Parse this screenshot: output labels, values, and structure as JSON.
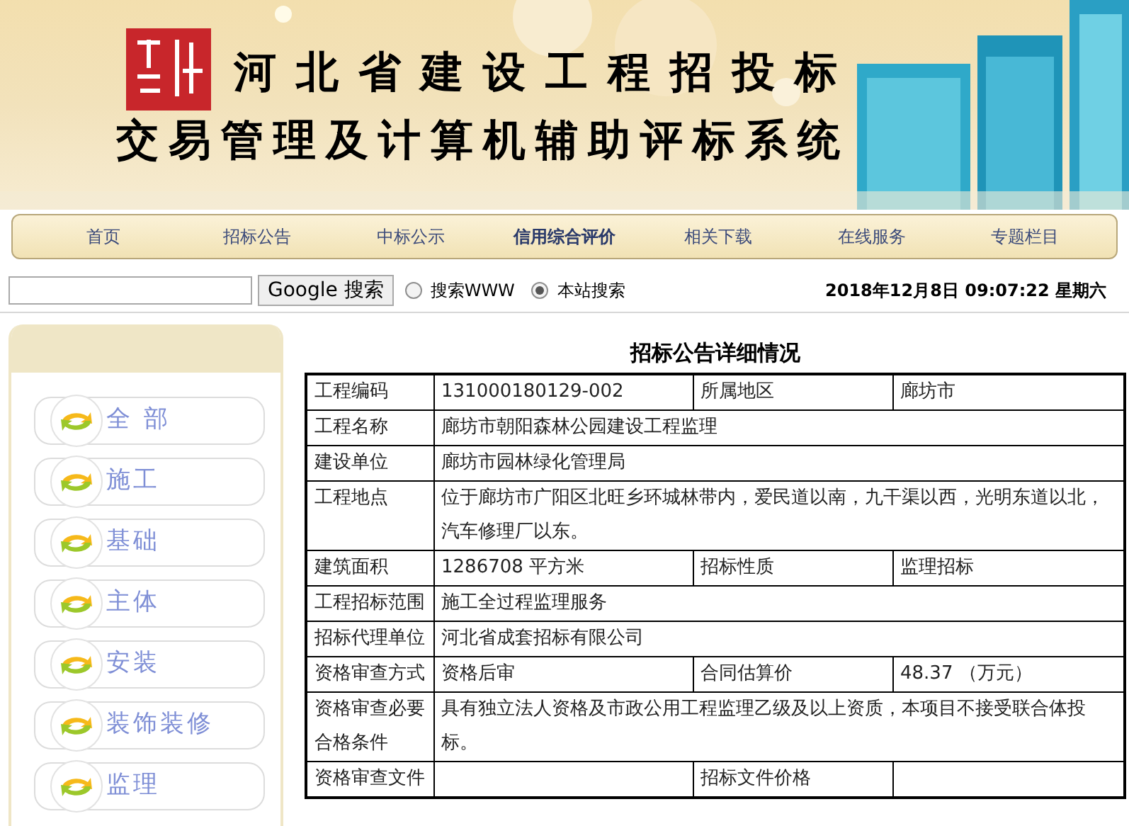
{
  "banner": {
    "title_line_1": "河北省建设工程招投标",
    "title_line_2": "交易管理及计算机辅助评标系统"
  },
  "nav": [
    {
      "label": "首页",
      "selected": false
    },
    {
      "label": "招标公告",
      "selected": false
    },
    {
      "label": "中标公示",
      "selected": false
    },
    {
      "label": "信用综合评价",
      "selected": true
    },
    {
      "label": "相关下载",
      "selected": false
    },
    {
      "label": "在线服务",
      "selected": false
    },
    {
      "label": "专题栏目",
      "selected": false
    }
  ],
  "search": {
    "button": "Google 搜索",
    "options": [
      {
        "label": "搜索WWW",
        "selected": false
      },
      {
        "label": "本站搜索",
        "selected": true
      }
    ]
  },
  "datetime": "2018年12月8日 09:07:22 星期六",
  "sidebar": {
    "items": [
      "全 部",
      "施工",
      "基础",
      "主体",
      "安装",
      "装饰装修",
      "监理"
    ]
  },
  "detail": {
    "title": "招标公告详细情况",
    "rows": [
      {
        "kind": "split",
        "label": "工程编码",
        "value": "131000180129-002",
        "label_2": "所属地区",
        "value_2": "廊坊市"
      },
      {
        "kind": "wide",
        "label": "工程名称",
        "value": "廊坊市朝阳森林公园建设工程监理"
      },
      {
        "kind": "wide",
        "label": "建设单位",
        "value": "廊坊市园林绿化管理局"
      },
      {
        "kind": "wide",
        "label": "工程地点",
        "value": "位于廊坊市广阳区北旺乡环城林带内，爱民道以南，九干渠以西，光明东道以北，汽车修理厂以东。"
      },
      {
        "kind": "split",
        "label": "建筑面积",
        "value": "1286708 平方米",
        "label_2": "招标性质",
        "value_2": "监理招标"
      },
      {
        "kind": "wide",
        "label": "工程招标范围",
        "value": "施工全过程监理服务"
      },
      {
        "kind": "wide",
        "label": "招标代理单位",
        "value": "河北省成套招标有限公司"
      },
      {
        "kind": "split",
        "label": "资格审查方式",
        "value": "资格后审",
        "label_2": "合同估算价",
        "value_2": "48.37 （万元）"
      },
      {
        "kind": "wide",
        "label": "资格审查必要合格条件",
        "value": "具有独立法人资格及市政公用工程监理乙级及以上资质，本项目不接受联合体投标。"
      },
      {
        "kind": "split",
        "label": "资格审查文件",
        "label_2": "招标文件价格"
      }
    ]
  }
}
